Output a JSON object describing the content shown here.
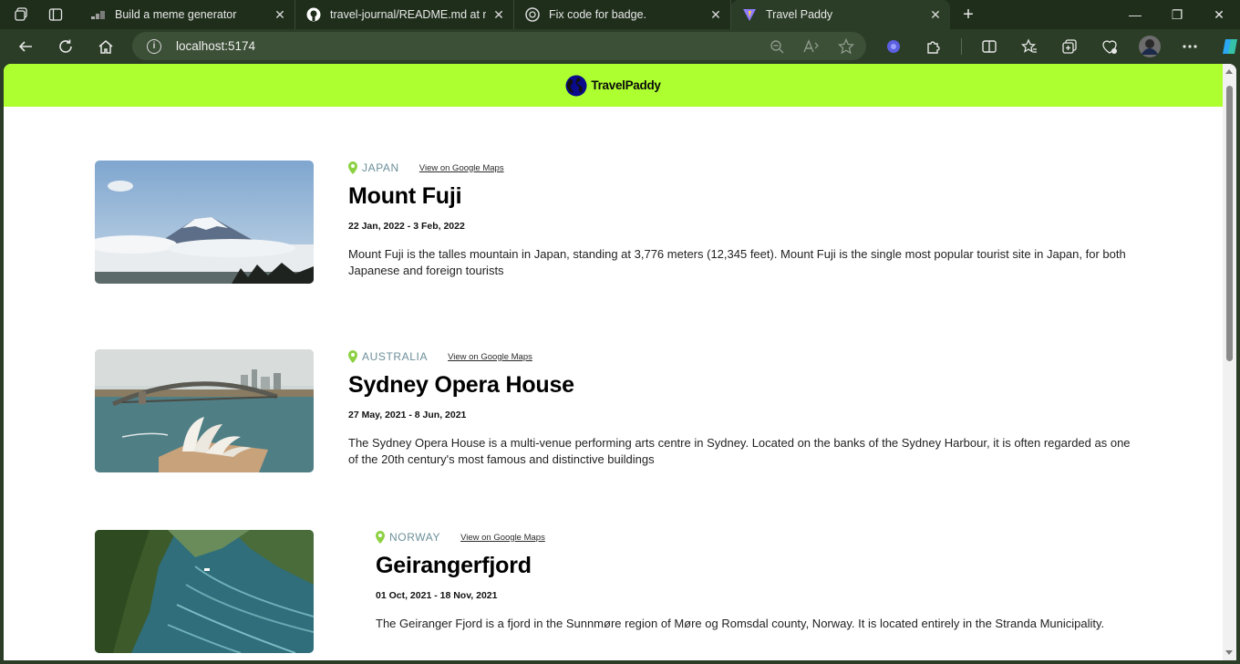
{
  "browser": {
    "tabs": [
      {
        "title": "Build a meme generator",
        "icon": "scrimba-icon"
      },
      {
        "title": "travel-journal/README.md at ma",
        "icon": "github-icon"
      },
      {
        "title": "Fix code for badge.",
        "icon": "chatgpt-icon"
      },
      {
        "title": "Travel Paddy",
        "icon": "vite-icon",
        "active": true
      }
    ],
    "address": "localhost:5174"
  },
  "site": {
    "brand": "TravelPaddy",
    "accent": "#adff2f"
  },
  "entries": [
    {
      "country": "JAPAN",
      "maps_link": "View on Google Maps",
      "title": "Mount Fuji",
      "dates": "22 Jan, 2022 - 3 Feb, 2022",
      "description": "Mount Fuji is the talles mountain in Japan, standing at 3,776 meters (12,345 feet). Mount Fuji is the single most popular tourist site in Japan, for both Japanese and foreign tourists"
    },
    {
      "country": "AUSTRALIA",
      "maps_link": "View on Google Maps",
      "title": "Sydney Opera House",
      "dates": "27 May, 2021 - 8 Jun, 2021",
      "description": "The Sydney Opera House is a multi-venue performing arts centre in Sydney. Located on the banks of the Sydney Harbour, it is often regarded as one of the 20th century's most famous and distinctive buildings"
    },
    {
      "country": "NORWAY",
      "maps_link": "View on Google Maps",
      "title": "Geirangerfjord",
      "dates": "01 Oct, 2021 - 18 Nov, 2021",
      "description": "The Geiranger Fjord is a fjord in the Sunnmøre region of Møre og Romsdal county, Norway. It is located entirely in the Stranda Municipality."
    }
  ]
}
